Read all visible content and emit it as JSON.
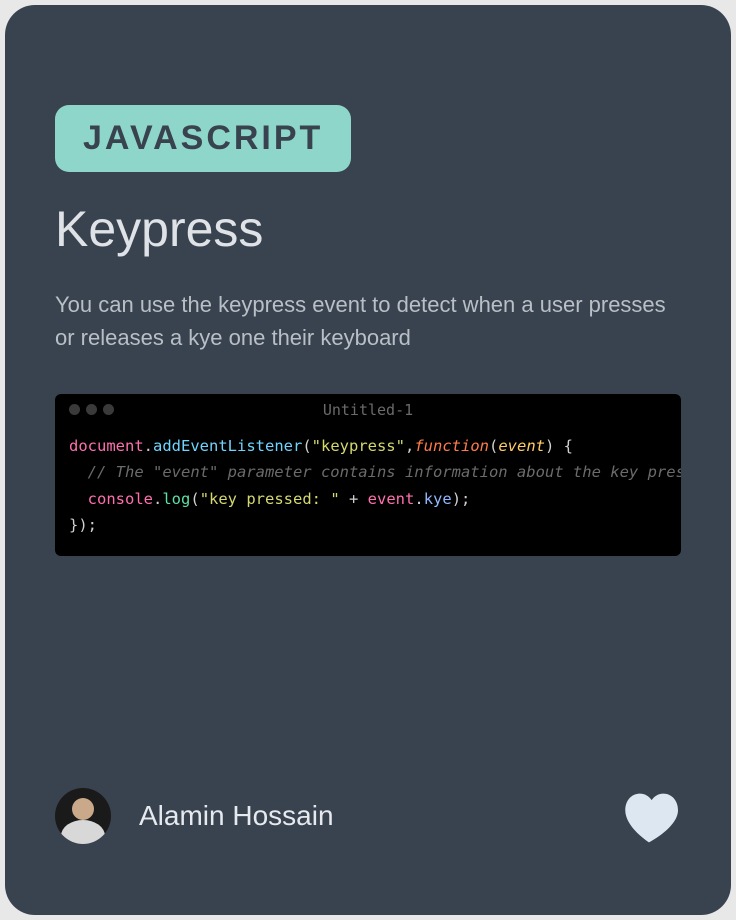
{
  "badge": "JAVASCRIPT",
  "title": "Keypress",
  "description": "You can use the keypress event to detect when a user presses or releases a kye  one their keyboard",
  "editor": {
    "title": "Untitled-1",
    "code": {
      "t1": "document",
      "t3": "addEventListener",
      "t5": "\"keypress\"",
      "t7": "function",
      "t9": "event",
      "t12": "// The \"event\" parameter contains information about the key press",
      "t13": "console",
      "t15": "log",
      "t17": "\"key pressed: \"",
      "t19": "event",
      "t21": "kye",
      "punct_dot": ".",
      "punct_open": "(",
      "punct_comma": ",",
      "punct_close": ")",
      "punct_brace_o": " {",
      "punct_plus": " + ",
      "punct_semi": ";",
      "punct_end": "});"
    }
  },
  "author": "Alamin Hossain",
  "colors": {
    "accent": "#8ed6ca",
    "bg": "#39434f",
    "heart": "#dde7f2"
  }
}
